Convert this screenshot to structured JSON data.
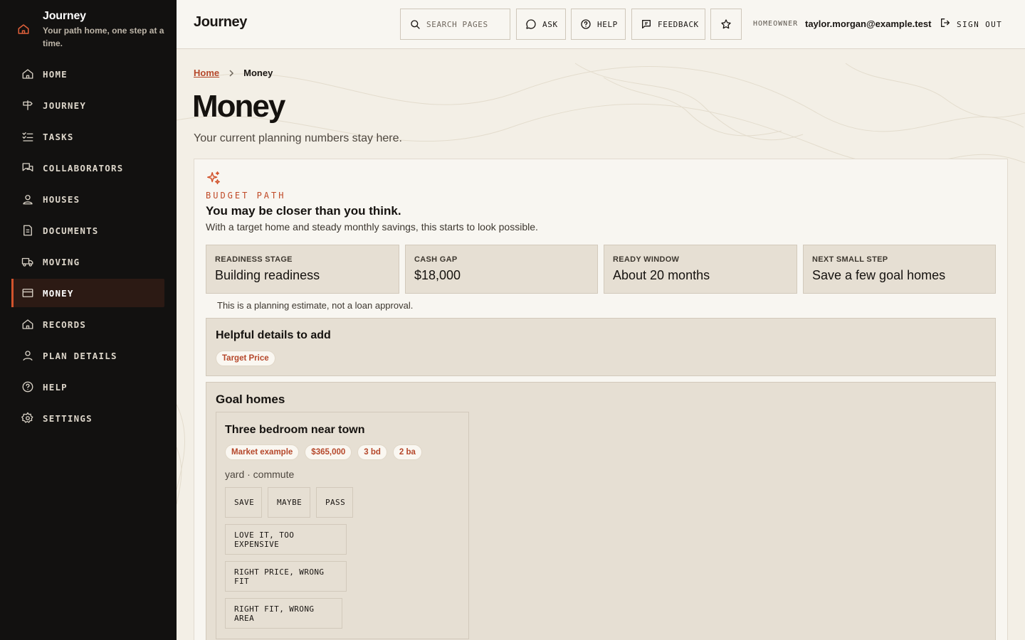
{
  "brand": {
    "title": "Journey",
    "subtitle": "Your path home, one step at a time."
  },
  "sidebar": {
    "items": [
      {
        "label": "HOME",
        "icon": "home-icon"
      },
      {
        "label": "JOURNEY",
        "icon": "signpost-icon"
      },
      {
        "label": "TASKS",
        "icon": "checklist-icon"
      },
      {
        "label": "COLLABORATORS",
        "icon": "chat-icon"
      },
      {
        "label": "HOUSES",
        "icon": "user-house-icon"
      },
      {
        "label": "DOCUMENTS",
        "icon": "document-icon"
      },
      {
        "label": "MOVING",
        "icon": "truck-icon"
      },
      {
        "label": "MONEY",
        "icon": "card-icon",
        "active": true
      },
      {
        "label": "RECORDS",
        "icon": "house-icon"
      },
      {
        "label": "PLAN DETAILS",
        "icon": "person-icon"
      },
      {
        "label": "HELP",
        "icon": "help-icon"
      },
      {
        "label": "SETTINGS",
        "icon": "gear-icon"
      }
    ]
  },
  "topbar": {
    "title": "Journey",
    "search_placeholder": "SEARCH PAGES",
    "ask": "ASK",
    "help": "HELP",
    "feedback": "FEEDBACK",
    "role": "HOMEOWNER",
    "email": "taylor.morgan@example.test",
    "signout": "SIGN OUT"
  },
  "breadcrumb": {
    "home": "Home",
    "current": "Money"
  },
  "page": {
    "title": "Money",
    "subtitle": "Your current planning numbers stay here."
  },
  "budget": {
    "eyebrow": "BUDGET PATH",
    "headline": "You may be closer than you think.",
    "lead": "With a target home and steady monthly savings, this starts to look possible.",
    "stats": [
      {
        "label": "READINESS STAGE",
        "value": "Building readiness"
      },
      {
        "label": "CASH GAP",
        "value": "$18,000"
      },
      {
        "label": "READY WINDOW",
        "value": "About 20 months"
      },
      {
        "label": "NEXT SMALL STEP",
        "value": "Save a few goal homes"
      }
    ],
    "disclaimer": "This is a planning estimate, not a loan approval."
  },
  "details": {
    "title": "Helpful details to add",
    "chip": "Target Price"
  },
  "goals": {
    "title": "Goal homes",
    "home": {
      "name": "Three bedroom near town",
      "tags": [
        "Market example",
        "$365,000",
        "3 bd",
        "2 ba"
      ],
      "features": "yard · commute",
      "actions": {
        "save": "SAVE",
        "maybe": "MAYBE",
        "pass": "PASS",
        "love": "LOVE IT, TOO EXPENSIVE",
        "price": "RIGHT PRICE, WRONG FIT",
        "area": "RIGHT FIT, WRONG AREA"
      }
    }
  },
  "colors": {
    "accent": "#d2532c",
    "sidebar_bg": "#121110",
    "page_bg": "#f3efe6",
    "card_bg": "#e6dfd3"
  }
}
